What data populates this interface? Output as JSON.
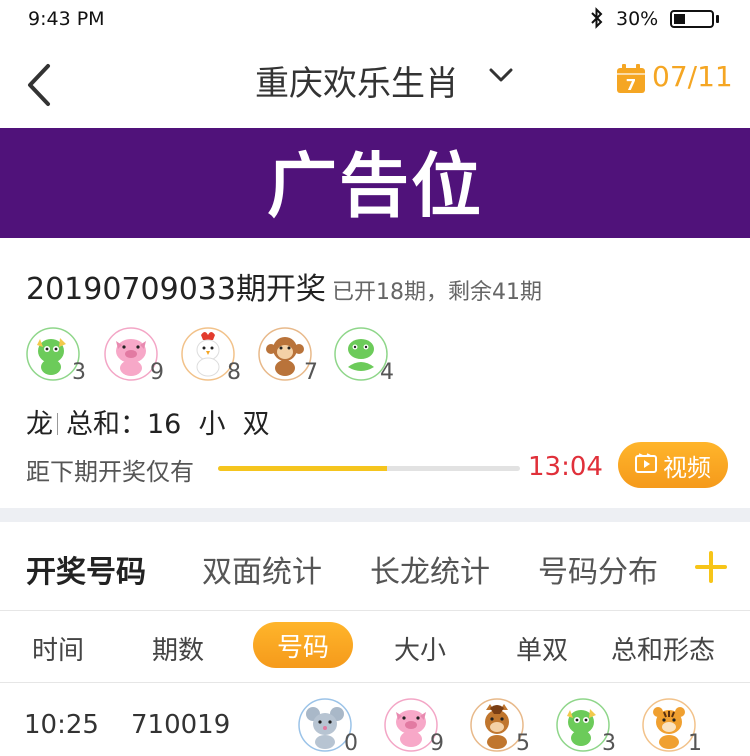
{
  "status_bar": {
    "time": "9:43 PM",
    "battery": "30%",
    "battery_level": 0.3
  },
  "nav": {
    "title": "重庆欢乐生肖",
    "date": "07/11",
    "calendar_day": "7"
  },
  "ad": {
    "text": "广告位"
  },
  "draw": {
    "title": "20190709033期开奖",
    "subtitle": "已开18期，剩余41期",
    "balls": [
      {
        "animal": "dragon-icon",
        "number": "3"
      },
      {
        "animal": "pig-icon",
        "number": "9"
      },
      {
        "animal": "rooster-icon",
        "number": "8"
      },
      {
        "animal": "monkey-icon",
        "number": "7"
      },
      {
        "animal": "snake-icon",
        "number": "4"
      }
    ],
    "summary_animal": "龙",
    "summary_text": "总和：16  小  双",
    "countdown_label": "距下期开奖仅有",
    "countdown_progress": 0.56,
    "countdown_time": "13:04",
    "video_label": "视频"
  },
  "tabs": [
    "开奖号码",
    "双面统计",
    "长龙统计",
    "号码分布"
  ],
  "sub_headers": [
    "时间",
    "期数",
    "号码",
    "大小",
    "单双",
    "总和形态"
  ],
  "rows": [
    {
      "time": "10:25",
      "issue": "710019",
      "balls": [
        {
          "animal": "rat-icon",
          "number": "0"
        },
        {
          "animal": "pig-icon",
          "number": "9"
        },
        {
          "animal": "horse-icon",
          "number": "5"
        },
        {
          "animal": "dragon-icon",
          "number": "3"
        },
        {
          "animal": "tiger-icon",
          "number": "1"
        }
      ]
    }
  ],
  "colors": {
    "accent": "#F5A623",
    "banner": "#50127A",
    "countdown": "#E0303A",
    "progress": "#F5C51E"
  }
}
